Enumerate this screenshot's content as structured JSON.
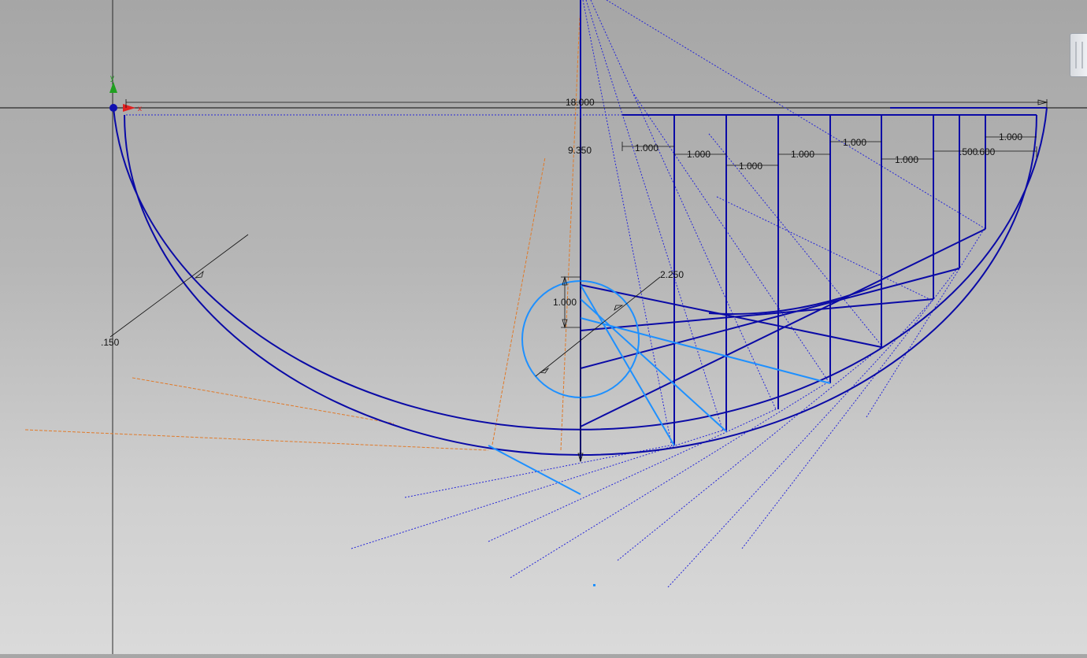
{
  "dimensions": {
    "overall_width": "18.000",
    "depth": "9.350",
    "wall_thickness": ".150",
    "circle_diameter": "2.250",
    "hole_offset": "1.000",
    "spacing_1": "1.000",
    "spacing_2": "1.000",
    "spacing_3": "1.000",
    "spacing_4": "1.000",
    "spacing_5": "1.000",
    "spacing_6": "1.000",
    "spacing_7": ".500",
    "spacing_8": ".600",
    "spacing_9": "1.000"
  },
  "axes": {
    "x_label": "x",
    "y_label": "y"
  },
  "colors": {
    "geometry": "#0a0aa6",
    "selected": "#1e90ff",
    "construction": "#2626d8",
    "reference": "#e07a2a",
    "dimension": "#111111",
    "x_axis": "#e02020",
    "y_axis": "#20a020"
  }
}
